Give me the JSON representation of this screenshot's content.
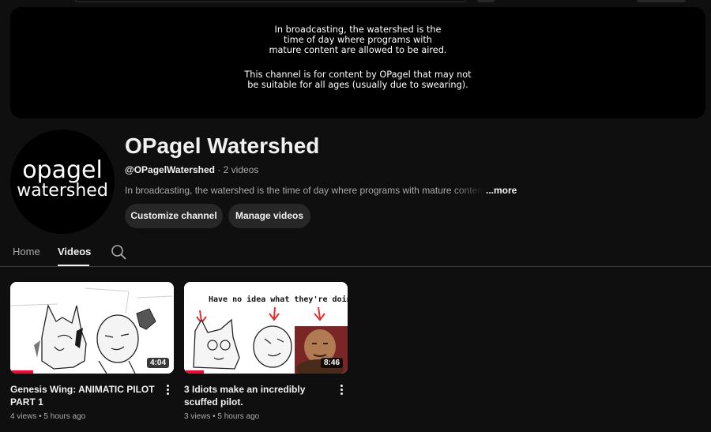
{
  "colors": {
    "background": "#0f0f0f",
    "surface": "#272727",
    "text_primary": "#f1f1f1",
    "text_secondary": "#aaaaaa",
    "progress": "#ff0033"
  },
  "banner": {
    "paragraph1": [
      "In broadcasting, the watershed is the",
      "time of day where programs with",
      "mature content are allowed to be aired."
    ],
    "paragraph2": [
      "This channel is for content by OPagel that may not",
      "be suitable for all ages (usually due to swearing)."
    ]
  },
  "avatar": {
    "line1": "opagel",
    "line2": "watershed"
  },
  "channel": {
    "name": "OPagel Watershed",
    "handle": "@OPagelWatershed",
    "separator": "·",
    "video_count": "2 videos",
    "description": "In broadcasting, the watershed is the time of day where programs with mature content are allowed to be aired.",
    "more_label": "...more"
  },
  "actions": {
    "customize": "Customize channel",
    "manage": "Manage videos"
  },
  "tabs": [
    {
      "label": "Home",
      "selected": false
    },
    {
      "label": "Videos",
      "selected": true
    }
  ],
  "icons": {
    "tab_search": "search-icon",
    "video_menu": "more-vert-icon"
  },
  "videos": [
    {
      "title": "Genesis Wing: ANIMATIC PILOT PART 1",
      "duration": "4:04",
      "views": "4 views",
      "age": "5 hours ago",
      "meta": "4 views • 5 hours ago",
      "watched_fraction": 0.14,
      "thumbnail_text": ""
    },
    {
      "title": "3 Idiots make an incredibly scuffed pilot.",
      "duration": "8:46",
      "views": "3 views",
      "age": "5 hours ago",
      "meta": "3 views • 5 hours ago",
      "watched_fraction": 0.12,
      "thumbnail_text": "Have no idea what they're doing"
    }
  ]
}
